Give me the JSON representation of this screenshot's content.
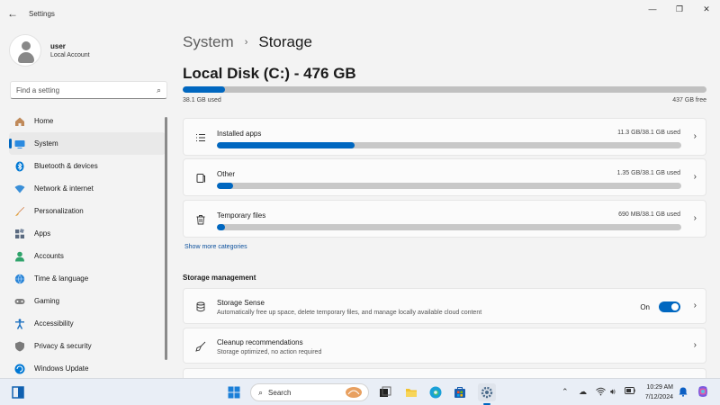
{
  "app": {
    "title": "Settings",
    "back_icon": "back-arrow-icon"
  },
  "user": {
    "name": "user",
    "account_type": "Local Account"
  },
  "search": {
    "placeholder": "Find a setting"
  },
  "sidebar": {
    "items": [
      {
        "label": "Home",
        "icon": "home-icon",
        "color": "#9a6b4a"
      },
      {
        "label": "System",
        "icon": "system-icon",
        "color": "#0078d4",
        "active": true
      },
      {
        "label": "Bluetooth & devices",
        "icon": "bluetooth-icon",
        "color": "#0078d4"
      },
      {
        "label": "Network & internet",
        "icon": "wifi-icon",
        "color": "#3a8fd8"
      },
      {
        "label": "Personalization",
        "icon": "brush-icon",
        "color": "#d07030"
      },
      {
        "label": "Apps",
        "icon": "apps-icon",
        "color": "#5a6a80"
      },
      {
        "label": "Accounts",
        "icon": "account-icon",
        "color": "#2fa36b"
      },
      {
        "label": "Time & language",
        "icon": "globe-icon",
        "color": "#2a84d6"
      },
      {
        "label": "Gaming",
        "icon": "gamepad-icon",
        "color": "#707070"
      },
      {
        "label": "Accessibility",
        "icon": "accessibility-icon",
        "color": "#1a6fc0"
      },
      {
        "label": "Privacy & security",
        "icon": "shield-icon",
        "color": "#707070"
      },
      {
        "label": "Windows Update",
        "icon": "update-icon",
        "color": "#0078d4"
      }
    ]
  },
  "breadcrumb": {
    "parent": "System",
    "current": "Storage"
  },
  "disk": {
    "title": "Local Disk (C:) - 476 GB",
    "used_label": "38.1 GB used",
    "free_label": "437 GB free",
    "used_fraction": 0.08
  },
  "categories": [
    {
      "name": "Installed apps",
      "size": "11.3 GB/38.1 GB used",
      "fraction": 0.297,
      "icon": "list-icon"
    },
    {
      "name": "Other",
      "size": "1.35 GB/38.1 GB used",
      "fraction": 0.035,
      "icon": "document-icon"
    },
    {
      "name": "Temporary files",
      "size": "690 MB/38.1 GB used",
      "fraction": 0.018,
      "icon": "trash-icon"
    }
  ],
  "show_more": "Show more categories",
  "management": {
    "section_title": "Storage management",
    "storage_sense": {
      "name": "Storage Sense",
      "description": "Automatically free up space, delete temporary files, and manage locally available cloud content",
      "toggle_label": "On"
    },
    "cleanup": {
      "name": "Cleanup recommendations",
      "description": "Storage optimized, no action required"
    }
  },
  "taskbar": {
    "search_label": "Search",
    "time": "10:29 AM",
    "date": "7/12/2024"
  }
}
